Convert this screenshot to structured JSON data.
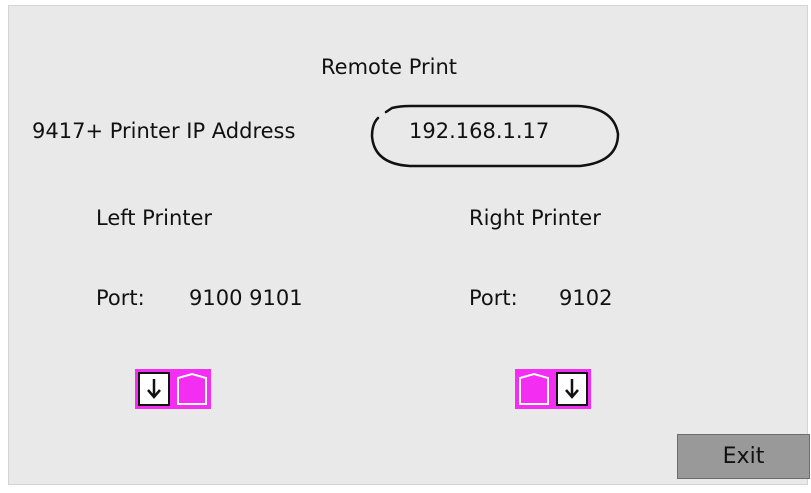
{
  "window": {
    "title": "Remote Print"
  },
  "ip": {
    "label": "9417+ Printer IP Address",
    "value": "192.168.1.17"
  },
  "left_printer": {
    "title": "Left Printer",
    "port_label": "Port:",
    "ports": "9100 9101",
    "icon": "left-printer-status-icon"
  },
  "right_printer": {
    "title": "Right Printer",
    "port_label": "Port:",
    "ports": "9102",
    "icon": "right-printer-status-icon"
  },
  "actions": {
    "exit_label": "Exit"
  },
  "colors": {
    "panel_background": "#e9e9e9",
    "slot_magenta": "#f42df2",
    "exit_button": "#999999",
    "text": "#111111"
  }
}
